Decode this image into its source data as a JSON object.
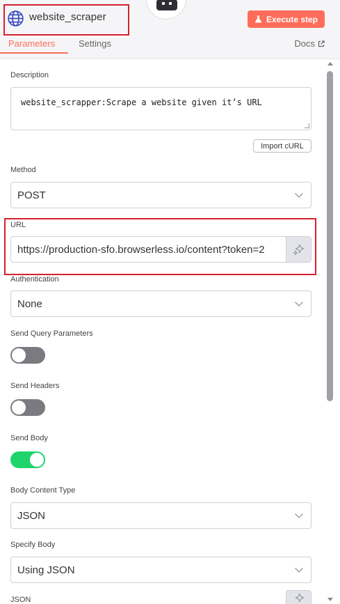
{
  "header": {
    "node_title": "website_scraper",
    "execute_label": "Execute step",
    "tabs": [
      "Parameters",
      "Settings"
    ],
    "docs_label": "Docs"
  },
  "fields": {
    "description_label": "Description",
    "description_value": "website_scrapper:Scrape a website given it’s URL",
    "import_curl_label": "Import cURL",
    "method_label": "Method",
    "method_value": "POST",
    "url_label": "URL",
    "url_value": "https://production-sfo.browserless.io/content?token=2",
    "auth_label": "Authentication",
    "auth_value": "None",
    "send_query_label": "Send Query Parameters",
    "send_query_on": false,
    "send_headers_label": "Send Headers",
    "send_headers_on": false,
    "send_body_label": "Send Body",
    "send_body_on": true,
    "body_type_label": "Body Content Type",
    "body_type_value": "JSON",
    "specify_body_label": "Specify Body",
    "specify_body_value": "Using JSON",
    "json_label": "JSON"
  },
  "colors": {
    "accent": "#ff6d5a",
    "toggle_on": "#1fd46a",
    "toggle_off": "#7a7a80",
    "highlight_border": "#d4202e"
  },
  "icons": {
    "node": "globe-icon",
    "execute": "flask-icon",
    "docs": "external-link-icon",
    "ai": "sparkle-icon",
    "dropdown": "chevron-down-icon"
  }
}
